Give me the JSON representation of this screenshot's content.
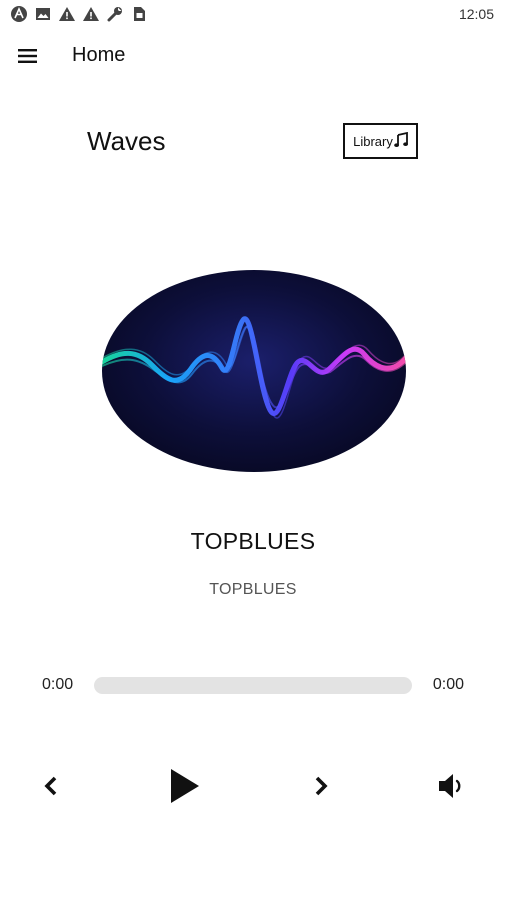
{
  "status_bar": {
    "time": "12:05",
    "icons": [
      "android-debug-icon",
      "image-icon",
      "warning-icon",
      "warning-icon",
      "wrench-icon",
      "sim-icon"
    ]
  },
  "app_bar": {
    "title": "Home",
    "menu_icon": "hamburger-menu-icon"
  },
  "header": {
    "brand": "Waves",
    "library_label": "Library",
    "library_icon": "music-note-icon"
  },
  "now_playing": {
    "title": "TOPBLUES",
    "artist": "TOPBLUES",
    "progress": 0
  },
  "playback": {
    "current_time": "0:00",
    "total_time": "0:00",
    "prev_icon": "chevron-left-icon",
    "play_icon": "play-icon",
    "next_icon": "chevron-right-icon",
    "volume_icon": "volume-icon"
  },
  "colors": {
    "accent": "#111111",
    "progress_track": "#e3e3e3",
    "artwork_bg": "#0d0f3a"
  }
}
